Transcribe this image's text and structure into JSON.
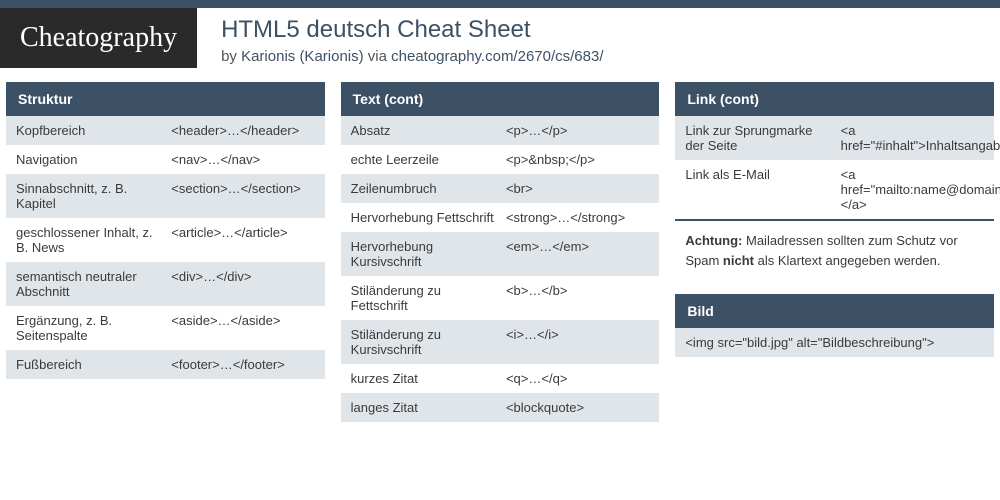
{
  "header": {
    "logo": "Cheatography",
    "title": "HTML5 deutsch Cheat Sheet",
    "by": "by ",
    "author": "Karionis (Karionis)",
    "via": " via ",
    "url": "cheatography.com/2670/cs/683/"
  },
  "col1": {
    "boxes": [
      {
        "title": "Struktur",
        "rows": [
          {
            "l": "Kopfbereich",
            "r": "<header>…</header>"
          },
          {
            "l": "Navigation",
            "r": "<nav>…</nav>"
          },
          {
            "l": "Sinnabschnitt, z. B. Kapitel",
            "r": "<section>…</section>"
          },
          {
            "l": "geschlossener Inhalt, z. B. News",
            "r": "<article>…</article>"
          },
          {
            "l": "semantisch neutraler Abschnitt",
            "r": "<div>…</div>"
          },
          {
            "l": "Ergänzung, z. B. Seitenspalte",
            "r": "<aside>…</aside>"
          },
          {
            "l": "Fußbereich",
            "r": "<footer>…</footer>"
          }
        ]
      }
    ]
  },
  "col2": {
    "boxes": [
      {
        "title": "Text (cont)",
        "rows": [
          {
            "l": "Absatz",
            "r": "<p>…</p>"
          },
          {
            "l": "echte Leerzeile",
            "r": "<p>&nbsp;</p>"
          },
          {
            "l": "Zeilenumbruch",
            "r": "<br>"
          },
          {
            "l": "Hervorhebung Fettschrift",
            "r": "<strong>…</strong>"
          },
          {
            "l": "Hervorhebung Kursivschrift",
            "r": "<em>…</em>"
          },
          {
            "l": "Stiländerung zu Fettschrift",
            "r": "<b>…</b>"
          },
          {
            "l": "Stiländerung zu Kursivschrift",
            "r": "<i>…</i>"
          },
          {
            "l": "kurzes Zitat",
            "r": "<q>…</q>"
          },
          {
            "l": "langes Zitat",
            "r": "<blockquote>"
          }
        ]
      }
    ]
  },
  "col3": {
    "boxes": [
      {
        "title": "Link (cont)",
        "rows": [
          {
            "l": "Link zur Sprungmarke der Seite",
            "r": "<a href=\"#inhalt\">Inhaltsangabe</a>"
          },
          {
            "l": "Link als E-Mail",
            "r": "<a href=\"mailto:name@domain.de\"></a>"
          }
        ],
        "note_prefix": "Achtung:",
        "note_body": " Mailadressen sollten zum Schutz vor Spam ",
        "note_bold": "nicht",
        "note_tail": " als Klartext angegeben werden."
      },
      {
        "title": "Bild",
        "rows": [
          {
            "l": "",
            "r": "<img src=\"bild.jpg\" alt=\"Bildbeschreibung\">",
            "full": true
          }
        ]
      }
    ]
  }
}
